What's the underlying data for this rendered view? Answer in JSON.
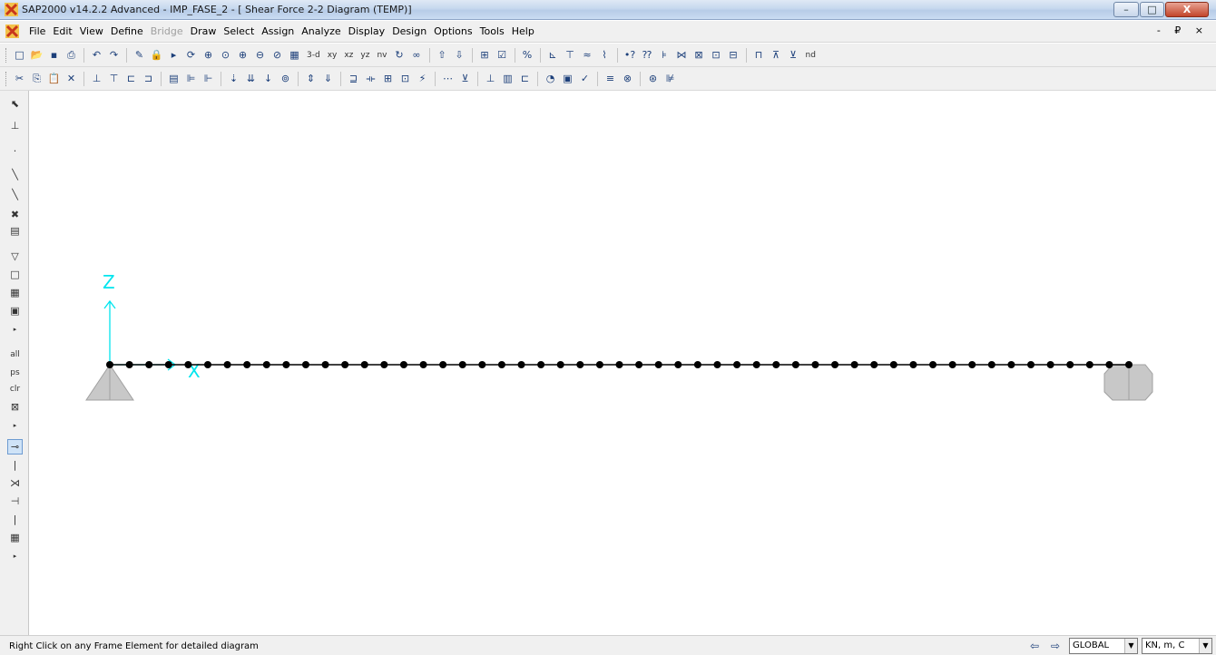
{
  "window": {
    "title": "SAP2000 v14.2.2 Advanced  - IMP_FASE_2 - [ Shear Force 2-2 Diagram  (TEMP)]",
    "minimize": "–",
    "maximize": "□",
    "close": "X",
    "child_controls": "- ₽ ×"
  },
  "menu": {
    "items": [
      "File",
      "Edit",
      "View",
      "Define",
      "Bridge",
      "Draw",
      "Select",
      "Assign",
      "Analyze",
      "Display",
      "Design",
      "Options",
      "Tools",
      "Help"
    ]
  },
  "toolbar1": {
    "view_3d": "3-d",
    "view_xy": "xy",
    "view_xz": "xz",
    "view_yz": "yz",
    "view_nv": "nv",
    "nd_label": "nd"
  },
  "canvas": {
    "axis_z_label": "Z",
    "axis_x_label": "X",
    "frame_joint_count": 53
  },
  "lefttoolbar": {
    "all_label": "all",
    "ps_label": "ps",
    "clr_label": "clr"
  },
  "statusbar": {
    "message": "Right Click on any Frame Element for detailed diagram",
    "coord_system": "GLOBAL",
    "units": "KN, m, C"
  },
  "colors": {
    "axis": "#00e5ee",
    "frame": "#000000",
    "support": "#c0c0c0"
  }
}
